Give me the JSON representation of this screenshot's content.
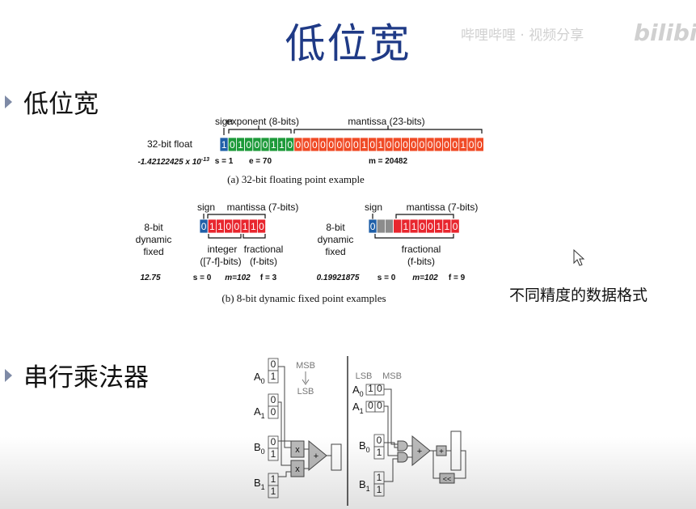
{
  "slide": {
    "title": "低位宽",
    "watermark_text": "哔哩哔哩 · 视频分享",
    "watermark_logo": "bilibili",
    "bullets": [
      {
        "label": "低位宽"
      },
      {
        "label": "串行乘法器"
      }
    ],
    "side_caption": "不同精度的数据格式"
  },
  "float_example": {
    "row_label": "32-bit float",
    "value": "-1.42122425 x 10",
    "value_exp": "-13",
    "sign_label": "sign",
    "exponent_label": "exponent (8-bits)",
    "mantissa_label": "mantissa (23-bits)",
    "sign_bit": "1",
    "exponent_bits": [
      "0",
      "1",
      "0",
      "0",
      "0",
      "1",
      "1",
      "0"
    ],
    "mantissa_bits": [
      "0",
      "0",
      "0",
      "0",
      "0",
      "0",
      "0",
      "0",
      "1",
      "0",
      "1",
      "0",
      "0",
      "0",
      "0",
      "0",
      "0",
      "0",
      "0",
      "0",
      "1",
      "0",
      "0"
    ],
    "s_text": "s = 1",
    "e_text": "e = 70",
    "m_text": "m = 20482",
    "caption": "(a)  32-bit floating point example"
  },
  "fixed_example": {
    "row_label_1": "8-bit",
    "row_label_2": "dynamic",
    "row_label_3": "fixed",
    "left": {
      "sign_label": "sign",
      "mantissa_label": "mantissa (7-bits)",
      "sign_bit": "0",
      "bits": [
        "1",
        "1",
        "0",
        "0",
        "1",
        "1",
        "0"
      ],
      "integer_label": "integer",
      "integer_sub": "([7-f]-bits)",
      "fractional_label": "fractional",
      "fractional_sub": "(f-bits)",
      "value": "12.75",
      "s_text": "s = 0",
      "m_text": "m=102",
      "f_text": "f = 3"
    },
    "right": {
      "sign_label": "sign",
      "mantissa_label": "mantissa (7-bits)",
      "sign_bit": "0",
      "bits": [
        "1",
        "1",
        "0",
        "0",
        "1",
        "1",
        "0"
      ],
      "fractional_label": "fractional",
      "fractional_sub": "(f-bits)",
      "value": "0.19921875",
      "s_text": "s = 0",
      "m_text": "m=102",
      "f_text": "f = 9"
    },
    "caption": "(b)  8-bit dynamic fixed point examples"
  },
  "multiplier": {
    "msb_label": "MSB",
    "lsb_label": "LSB",
    "lsb_label_2": "LSB",
    "msb_label_2": "MSB",
    "a0": "A",
    "a0_sub": "0",
    "a1": "A",
    "a1_sub": "1",
    "b0": "B",
    "b0_sub": "0",
    "b1": "B",
    "b1_sub": "1",
    "left_a0_bits": [
      "0",
      "1"
    ],
    "left_a1_bits": [
      "0",
      "0"
    ],
    "left_b0_bits": [
      "0",
      "1"
    ],
    "left_b1_bits": [
      "1",
      "1"
    ],
    "right_a0_bits": [
      "1",
      "0"
    ],
    "right_a1_bits": [
      "0",
      "0"
    ],
    "right_b0_bits": [
      "0",
      "1"
    ],
    "right_b1_bits": [
      "1",
      "1"
    ],
    "mult_symbol": "x",
    "plus_symbol": "+",
    "shift_symbol": "<<",
    "colors": {
      "sign": "#1f5fa8",
      "exponent": "#1d9a3a",
      "mantissa": "#f04a25",
      "fixed": "#e8262e",
      "gray": "#8c8c8c"
    }
  }
}
